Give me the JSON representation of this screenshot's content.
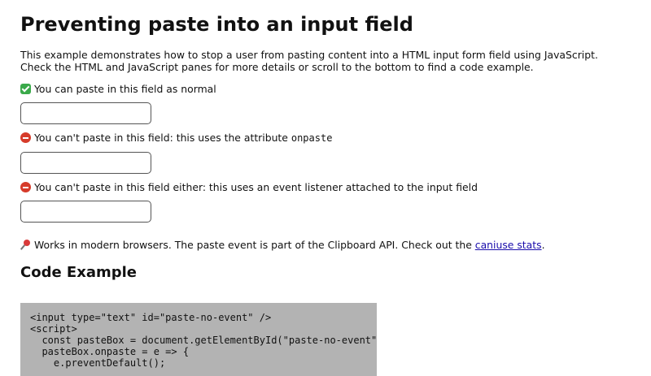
{
  "page": {
    "title": "Preventing paste into an input field",
    "intro": "This example demonstrates how to stop a user from pasting content into a HTML input form field using JavaScript. Check the HTML and JavaScript panes for more details or scroll to the bottom to find a code example."
  },
  "fields": [
    {
      "label": "You can paste in this field as normal",
      "icon": "check-mark-icon",
      "value": ""
    },
    {
      "label": "You can't paste in this field: this uses the attribute ",
      "label_code": "onpaste",
      "icon": "stop-sign-icon",
      "value": ""
    },
    {
      "label": "You can't paste in this field either: this uses an event listener attached to the input field",
      "icon": "stop-sign-icon",
      "value": ""
    }
  ],
  "note": {
    "icon": "pushpin-icon",
    "text_before": "Works in modern browsers. The paste event is part of the Clipboard API. Check out the ",
    "link_text": "caniuse stats",
    "text_after": "."
  },
  "code_section": {
    "heading": "Code Example",
    "code": "<input type=\"text\" id=\"paste-no-event\" />\n<script>\n  const pasteBox = document.getElementById(\"paste-no-event\");\n  pasteBox.onpaste = e => {\n    e.preventDefault();"
  },
  "colors": {
    "code_background": "#b3b3b3",
    "link": "#1a0dab"
  }
}
